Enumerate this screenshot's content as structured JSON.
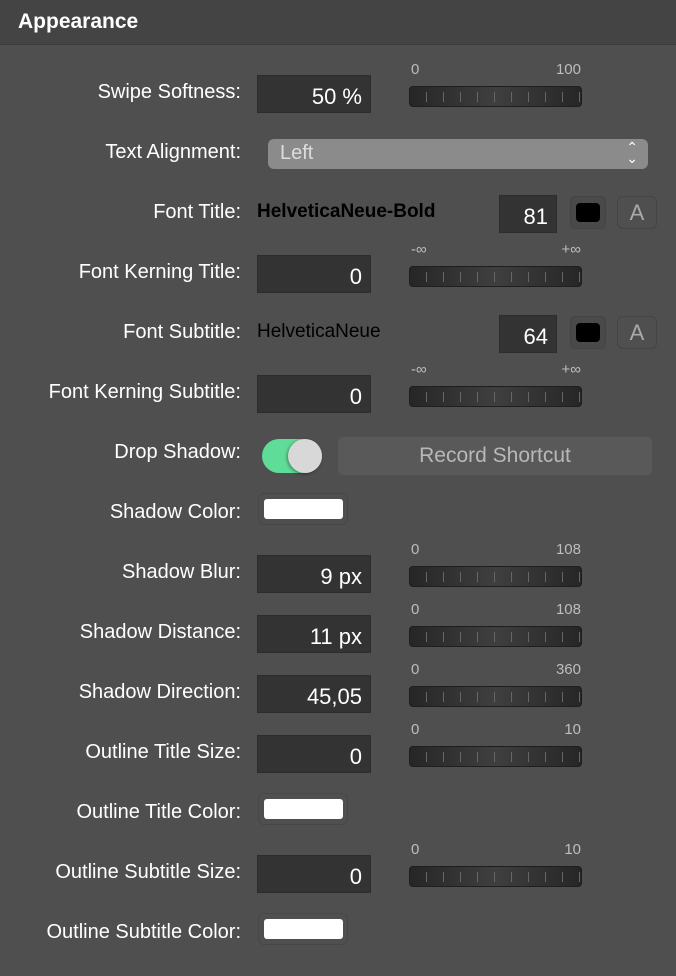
{
  "header": {
    "title": "Appearance"
  },
  "rows": [
    {
      "type": "slider",
      "label": "Swipe Softness:",
      "value": "50 %",
      "min": "0",
      "max": "100",
      "fraction": 0.5
    },
    {
      "type": "select",
      "label": "Text Alignment:",
      "value": "Left"
    },
    {
      "type": "font",
      "label": "Font Title:",
      "font": "HelveticaNeue-Bold",
      "bold": true,
      "size": "81",
      "color": "#000000",
      "font_button": "A"
    },
    {
      "type": "slider",
      "label": "Font Kerning Title:",
      "value": "0",
      "min": "-∞",
      "max": "+∞"
    },
    {
      "type": "font",
      "label": "Font Subtitle:",
      "font": "HelveticaNeue",
      "bold": false,
      "size": "64",
      "color": "#000000",
      "font_button": "A"
    },
    {
      "type": "slider",
      "label": "Font Kerning Subtitle:",
      "value": "0",
      "min": "-∞",
      "max": "+∞"
    },
    {
      "type": "toggle",
      "label": "Drop Shadow:",
      "on": true,
      "button": "Record Shortcut"
    },
    {
      "type": "color",
      "label": "Shadow Color:",
      "color": "#ffffff"
    },
    {
      "type": "slider",
      "label": "Shadow Blur:",
      "value": "9 px",
      "min": "0",
      "max": "108"
    },
    {
      "type": "slider",
      "label": "Shadow Distance:",
      "value": "11 px",
      "min": "0",
      "max": "108"
    },
    {
      "type": "slider",
      "label": "Shadow Direction:",
      "value": "45,05",
      "min": "0",
      "max": "360"
    },
    {
      "type": "slider",
      "label": "Outline Title Size:",
      "value": "0",
      "min": "0",
      "max": "10"
    },
    {
      "type": "color",
      "label": "Outline Title Color:",
      "color": "#ffffff"
    },
    {
      "type": "slider",
      "label": "Outline Subtitle Size:",
      "value": "0",
      "min": "0",
      "max": "10"
    },
    {
      "type": "color",
      "label": "Outline Subtitle Color:",
      "color": "#ffffff"
    }
  ],
  "colors": {
    "toggle_on": "#5fdc98",
    "background": "#4f4f4f",
    "field": "#333333"
  }
}
